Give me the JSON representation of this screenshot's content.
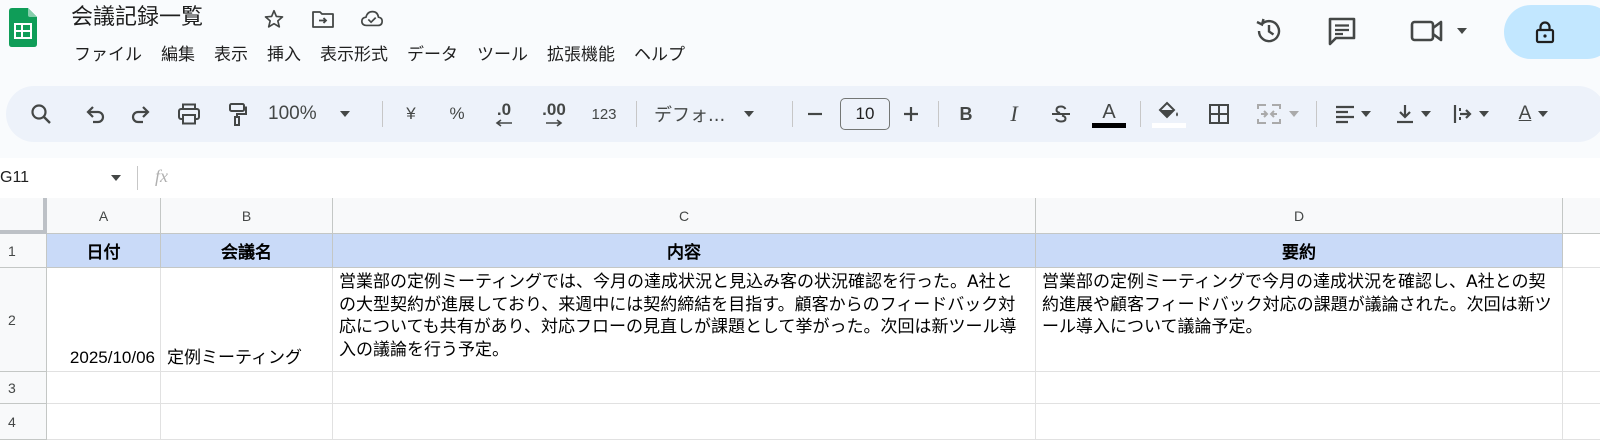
{
  "app": {
    "title": "会議記録一覧",
    "menu": [
      "ファイル",
      "編集",
      "表示",
      "挿入",
      "表示形式",
      "データ",
      "ツール",
      "拡張機能",
      "ヘルプ"
    ]
  },
  "header_icons": [
    "star-icon",
    "move-to-folder-icon",
    "cloud-saved-icon",
    "version-history-icon",
    "comments-icon",
    "meet-icon",
    "lock-icon"
  ],
  "toolbar": {
    "zoom": "100%",
    "currency_label": "¥",
    "percent_label": "%",
    "decrease_decimal_label": ".0",
    "increase_decimal_label": ".00",
    "more_formats_label": "123",
    "font": "デフォ...",
    "font_size": "10",
    "bold_label": "B",
    "italic_label": "I",
    "text_color_label": "A",
    "rotate_label": "A",
    "colors": {
      "text_color": "#000000",
      "fill_color": "#ffffff"
    }
  },
  "formula_bar": {
    "name_box": "G11",
    "fx_label": "fx",
    "value": ""
  },
  "grid": {
    "columns": [
      "A",
      "B",
      "C",
      "D"
    ],
    "rows": [
      "1",
      "2",
      "3",
      "4"
    ],
    "header_fill": "#c9daf8",
    "cells": {
      "A1": "日付",
      "B1": "会議名",
      "C1": "内容",
      "D1": "要約",
      "A2": "2025/10/06",
      "B2": "定例ミーティング",
      "C2": "営業部の定例ミーティングでは、今月の達成状況と見込み客の状況確認を行った。A社との大型契約が進展しており、来週中には契約締結を目指す。顧客からのフィードバック対応についても共有があり、対応フローの見直しが課題として挙がった。次回は新ツール導入の議論を行う予定。",
      "D2": "営業部の定例ミーティングで今月の達成状況を確認し、A社との契約進展や顧客フィードバック対応の課題が議論された。次回は新ツール導入について議論予定。"
    }
  }
}
